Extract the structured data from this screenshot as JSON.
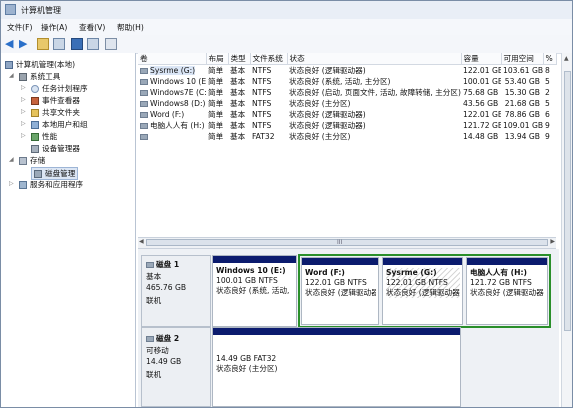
{
  "window": {
    "title": "计算机管理"
  },
  "menu": [
    "文件(F)",
    "操作(A)",
    "查看(V)",
    "帮助(H)"
  ],
  "tree": [
    {
      "label": "计算机管理(本地)",
      "icon": "computer-icon"
    },
    {
      "label": "系统工具",
      "icon": "tools-icon"
    },
    {
      "label": "任务计划程序",
      "icon": "clock-icon"
    },
    {
      "label": "事件查看器",
      "icon": "event-icon"
    },
    {
      "label": "共享文件夹",
      "icon": "folder-icon"
    },
    {
      "label": "本地用户和组",
      "icon": "users-icon"
    },
    {
      "label": "性能",
      "icon": "performance-icon"
    },
    {
      "label": "设备管理器",
      "icon": "device-icon"
    },
    {
      "label": "存储",
      "icon": "storage-icon"
    },
    {
      "label": "磁盘管理",
      "icon": "disk-icon"
    },
    {
      "label": "服务和应用程序",
      "icon": "services-icon"
    }
  ],
  "volume_table": {
    "headers": [
      "卷",
      "布局",
      "类型",
      "文件系统",
      "状态",
      "容量",
      "可用空间",
      "%"
    ],
    "rows": [
      [
        "Sysrme (G:)",
        "简单",
        "基本",
        "NTFS",
        "状态良好 (逻辑驱动器)",
        "122.01 GB",
        "103.61 GB",
        "8"
      ],
      [
        "Windows 10 (E:)",
        "简单",
        "基本",
        "NTFS",
        "状态良好 (系统, 活动, 主分区)",
        "100.01 GB",
        "53.40 GB",
        "5"
      ],
      [
        "Windows7E (C:)",
        "简单",
        "基本",
        "NTFS",
        "状态良好 (启动, 页面文件, 活动, 故障转储, 主分区)",
        "75.68 GB",
        "15.30 GB",
        "2"
      ],
      [
        "Windows8 (D:)",
        "简单",
        "基本",
        "NTFS",
        "状态良好 (主分区)",
        "43.56 GB",
        "21.68 GB",
        "5"
      ],
      [
        "Word (F:)",
        "简单",
        "基本",
        "NTFS",
        "状态良好 (逻辑驱动器)",
        "122.01 GB",
        "78.86 GB",
        "6"
      ],
      [
        "电脑人人有 (H:)",
        "简单",
        "基本",
        "NTFS",
        "状态良好 (逻辑驱动器)",
        "121.72 GB",
        "109.01 GB",
        "9"
      ],
      [
        "",
        "简单",
        "基本",
        "FAT32",
        "状态良好 (主分区)",
        "14.48 GB",
        "13.94 GB",
        "9"
      ]
    ]
  },
  "scroll_label": "III",
  "disk1": {
    "name": "磁盘 1",
    "type": "基本",
    "size": "465.76 GB",
    "status": "联机",
    "partitions": [
      {
        "name": "Windows 10  (E:)",
        "fs": "100.01 GB NTFS",
        "status": "状态良好 (系统, 活动,"
      },
      {
        "name": "Word  (F:)",
        "fs": "122.01 GB NTFS",
        "status": "状态良好 (逻辑驱动器)"
      },
      {
        "name": "Sysrme  (G:)",
        "fs": "122.01 GB NTFS",
        "status": "状态良好 (逻辑驱动器)"
      },
      {
        "name": "电脑人人有  (H:)",
        "fs": "121.72 GB NTFS",
        "status": "状态良好 (逻辑驱动器"
      }
    ]
  },
  "disk2": {
    "name": "磁盘 2",
    "type": "可移动",
    "size": "14.49 GB",
    "status": "联机",
    "partition": {
      "fs": "14.49 GB FAT32",
      "status": "状态良好 (主分区)"
    }
  },
  "colors": {
    "partition_bar": "#0b1b6e",
    "selection_border": "#2a8f2a"
  }
}
